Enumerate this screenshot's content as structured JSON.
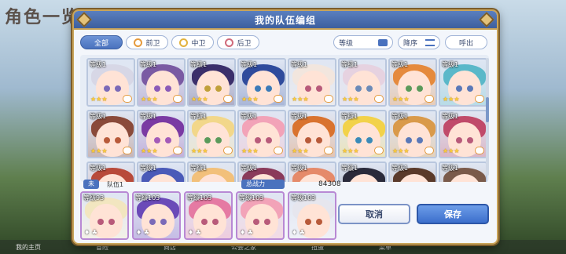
{
  "background": {
    "title": "角色一览",
    "bottom_nav": [
      "我的主页",
      "冒险",
      "商店",
      "公会之家",
      "扭蛋",
      "菜单"
    ]
  },
  "dialog": {
    "title": "我的队伍编组"
  },
  "filters": {
    "tabs": [
      {
        "label": "全部",
        "icon": ""
      },
      {
        "label": "前卫",
        "icon": "front-icon"
      },
      {
        "label": "中卫",
        "icon": "middle-icon"
      },
      {
        "label": "后卫",
        "icon": "back-icon"
      }
    ]
  },
  "controls": {
    "sort_by": "等级",
    "order": "降序",
    "call": "呼出"
  },
  "roster": {
    "row1": [
      {
        "level": "等级1",
        "stars": "★★★",
        "hair": "#d7d7e6",
        "eye": "#7a6ab8"
      },
      {
        "level": "等级1",
        "stars": "★★★",
        "hair": "#7a5aa3",
        "eye": "#8a5ab8"
      },
      {
        "level": "等级1",
        "stars": "★★★",
        "hair": "#3b2f6b",
        "eye": "#c0a03a"
      },
      {
        "level": "等级1",
        "stars": "★★★",
        "hair": "#2f4b9c",
        "eye": "#3a7ab8"
      },
      {
        "level": "等级1",
        "stars": "★★★",
        "hair": "#f2e6de",
        "eye": "#b85a7a"
      },
      {
        "level": "等级1",
        "stars": "★★★",
        "hair": "#e6d2e0",
        "eye": "#6a8ab8"
      },
      {
        "level": "等级1",
        "stars": "★★★",
        "hair": "#e58a3d",
        "eye": "#5a9a5a"
      },
      {
        "level": "等级1",
        "stars": "★★★",
        "hair": "#5ab8c9",
        "eye": "#5a78b8"
      }
    ],
    "row2": [
      {
        "level": "等级1",
        "stars": "★★★",
        "hair": "#8a4a3a",
        "eye": "#b85a3a"
      },
      {
        "level": "等级1",
        "stars": "★★★",
        "hair": "#7a3aa3",
        "eye": "#a35ab8"
      },
      {
        "level": "等级1",
        "stars": "★★★",
        "hair": "#f2d78a",
        "eye": "#5a9a5a"
      },
      {
        "level": "等级1",
        "stars": "★★★",
        "hair": "#f2a3b8",
        "eye": "#b85a7a"
      },
      {
        "level": "等级1",
        "stars": "★★★",
        "hair": "#d9732f",
        "eye": "#b85a3a"
      },
      {
        "level": "等级1",
        "stars": "★★★",
        "hair": "#f2d24a",
        "eye": "#3a8ab8"
      },
      {
        "level": "等级1",
        "stars": "★★★",
        "hair": "#d99a4a",
        "eye": "#5a78b8"
      },
      {
        "level": "等级1",
        "stars": "★★★",
        "hair": "#c04a6a",
        "eye": "#b85a7a"
      }
    ],
    "row3": [
      {
        "level": "等级1",
        "hair": "#b84a3a"
      },
      {
        "level": "等级1",
        "hair": "#4a5ab8"
      },
      {
        "level": "等级1",
        "hair": "#f2c07a"
      },
      {
        "level": "等级1",
        "hair": "#8a3a5a"
      },
      {
        "level": "等级1",
        "hair": "#e58a6a"
      },
      {
        "level": "等级1",
        "hair": "#2a2a3a"
      },
      {
        "level": "等级1",
        "hair": "#5a3a2a"
      },
      {
        "level": "等级1",
        "hair": "#7a5a4a"
      }
    ]
  },
  "party": {
    "tag": "未",
    "name": "队伍1",
    "power_label": "总战力",
    "power_value": "84308",
    "members": [
      {
        "level": "等级93",
        "hair": "#f2e6c0",
        "eye": "#b85a7a"
      },
      {
        "level": "等级103",
        "hair": "#6a4ab8",
        "eye": "#7a6ab8"
      },
      {
        "level": "等级103",
        "hair": "#e57aa3",
        "eye": "#b85a7a"
      },
      {
        "level": "等级103",
        "hair": "#f2a3b8",
        "eye": "#b85a7a"
      },
      {
        "level": "等级103",
        "hair": "#e6e6ee",
        "eye": "#b85a3a"
      }
    ]
  },
  "buttons": {
    "cancel": "取消",
    "save": "保存"
  }
}
